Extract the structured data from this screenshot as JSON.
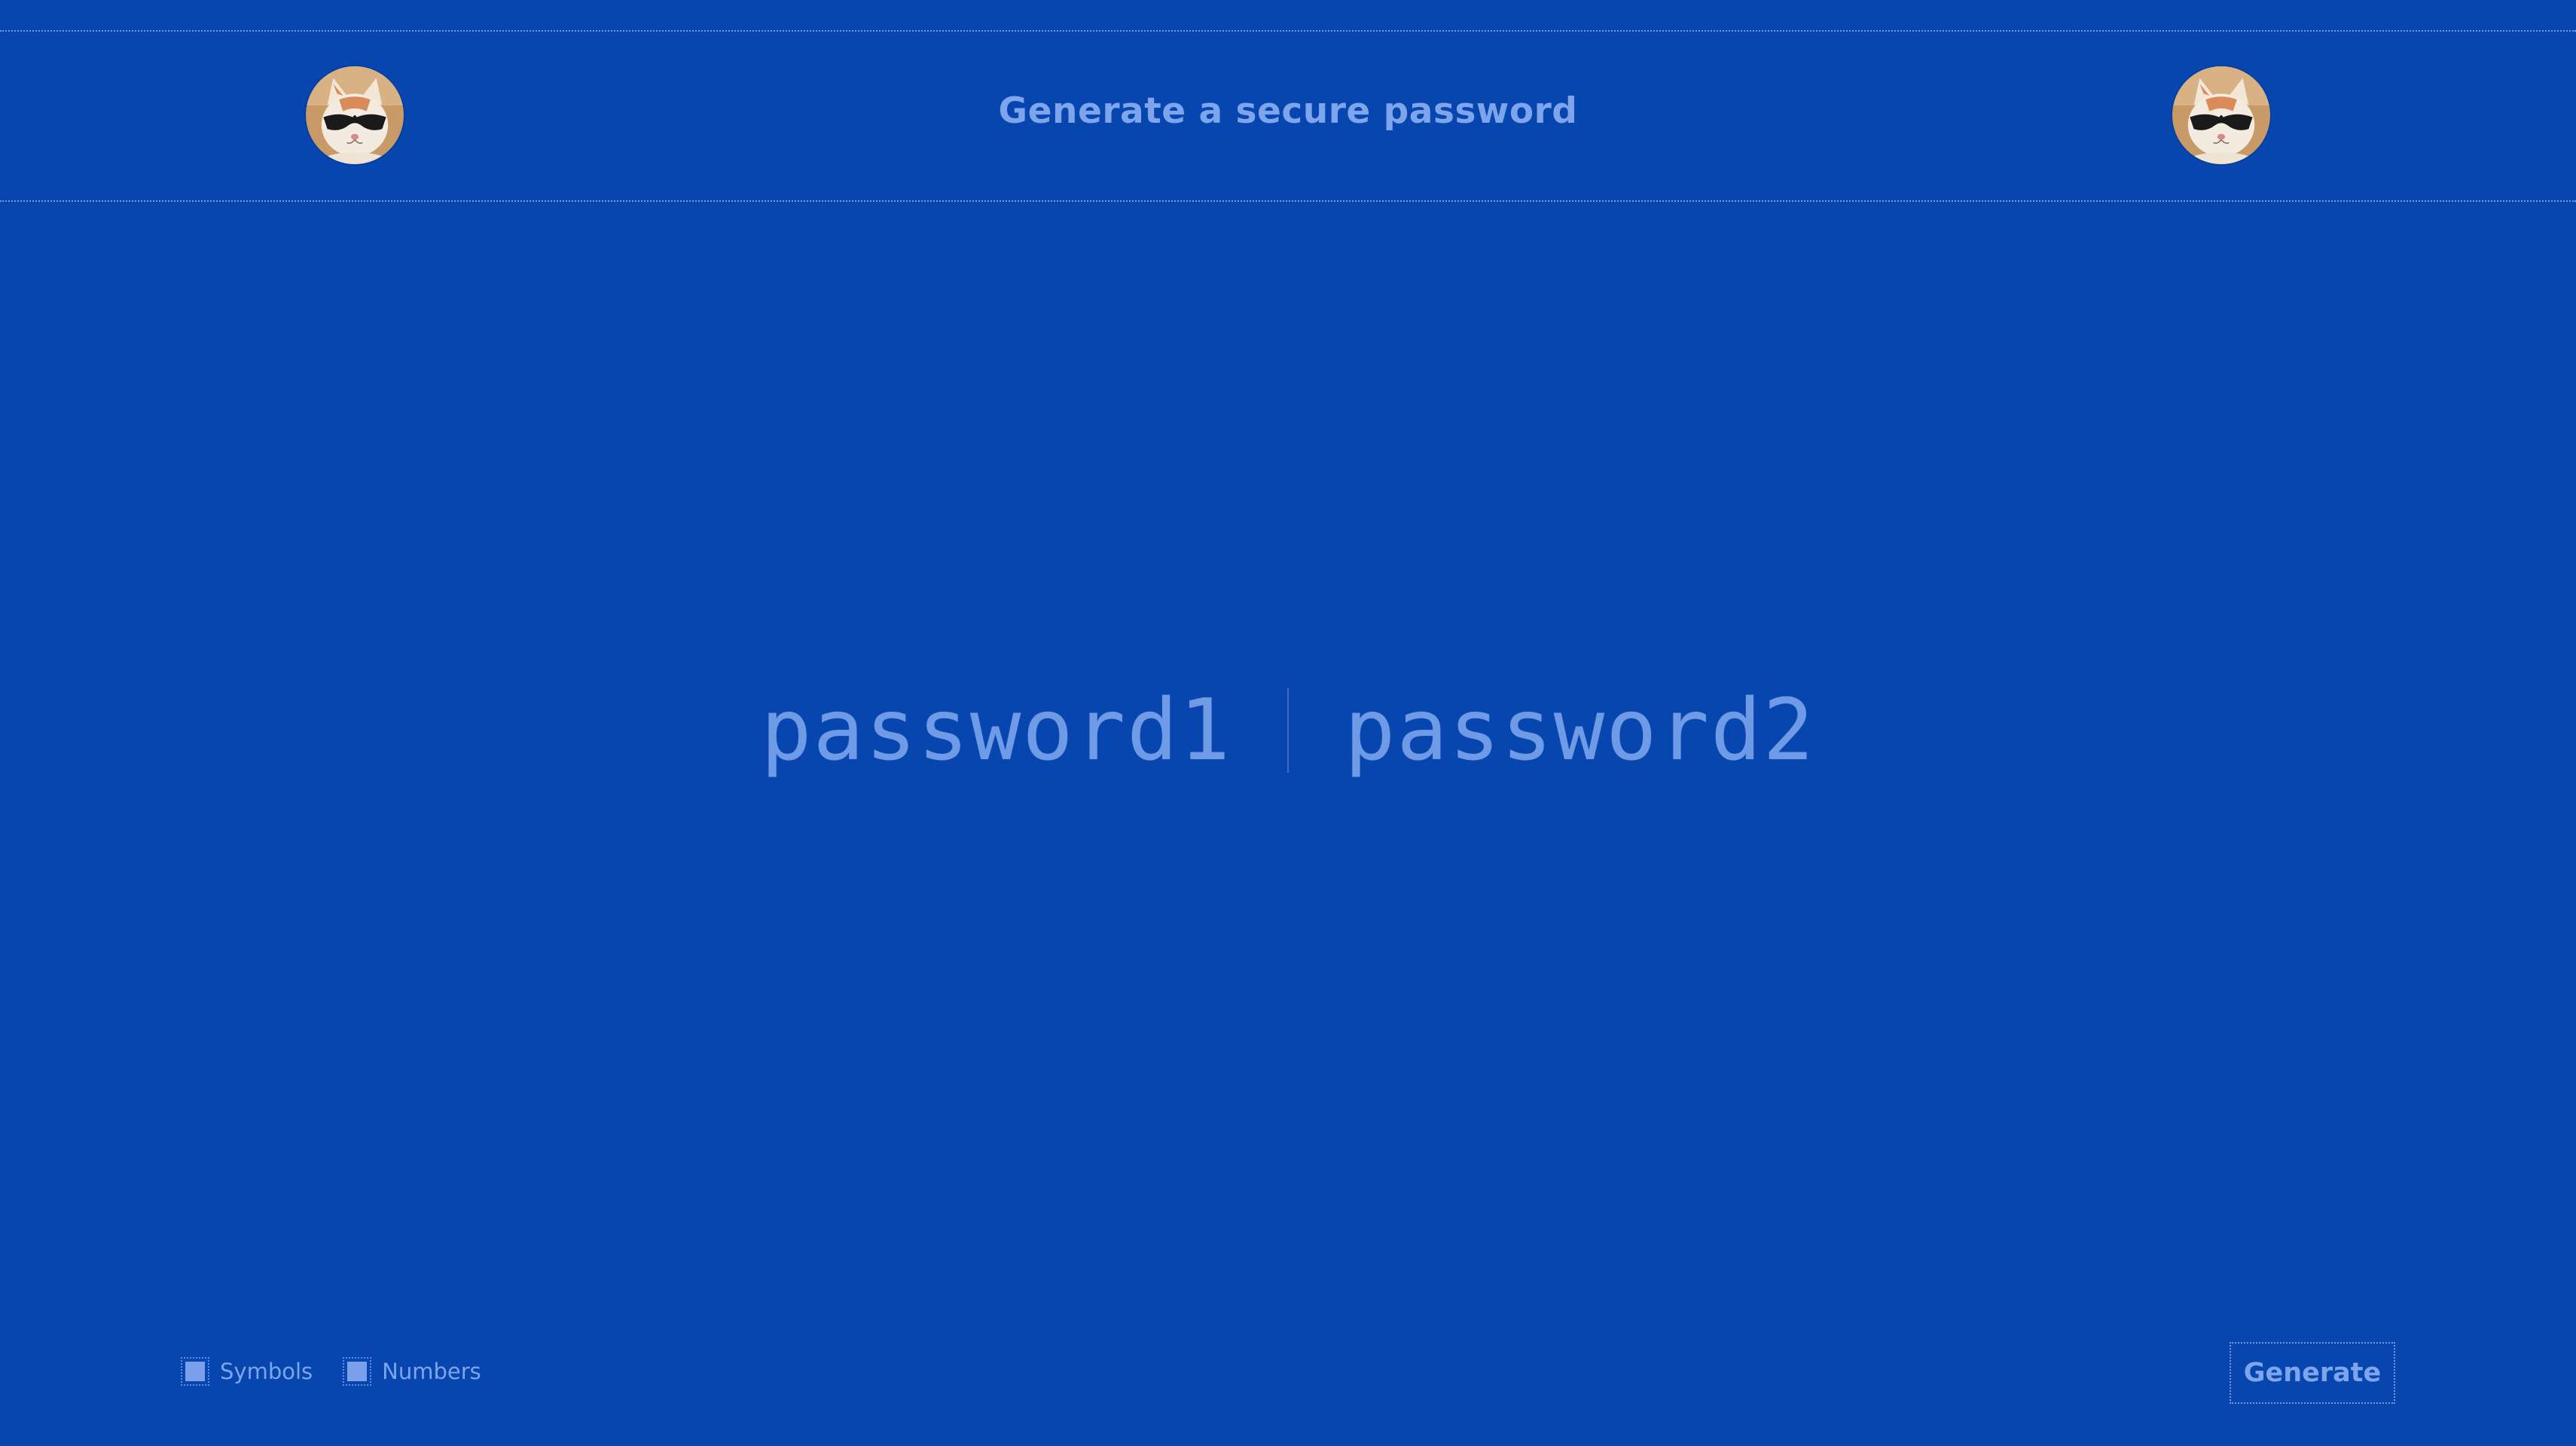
{
  "header": {
    "title": "Generate a secure password",
    "left_avatar_icon": "cat-sunglasses-avatar",
    "right_avatar_icon": "cat-sunglasses-avatar"
  },
  "passwords": [
    {
      "value": "password1"
    },
    {
      "value": "password2"
    }
  ],
  "options": [
    {
      "label": "Symbols",
      "checked": true
    },
    {
      "label": "Numbers",
      "checked": true
    }
  ],
  "actions": {
    "generate_label": "Generate"
  },
  "colors": {
    "background": "#0646ae",
    "accent": "#7ea4ec",
    "rule": "#6f9ae6"
  }
}
